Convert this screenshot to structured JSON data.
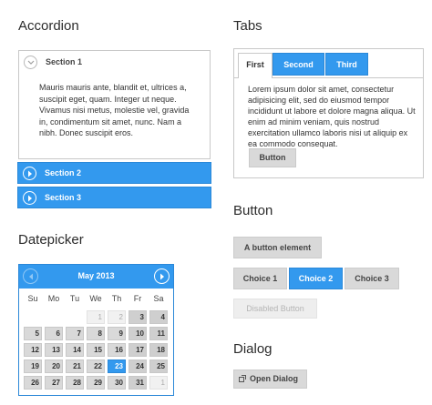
{
  "accordion": {
    "heading": "Accordion",
    "sections": [
      {
        "title": "Section 1",
        "body": "Mauris mauris ante, blandit et, ultrices a, suscipit eget, quam. Integer ut neque. Vivamus nisi metus, molestie vel, gravida in, condimentum sit amet, nunc. Nam a nibh. Donec suscipit eros."
      },
      {
        "title": "Section 2"
      },
      {
        "title": "Section 3"
      }
    ]
  },
  "tabs": {
    "heading": "Tabs",
    "items": [
      "First",
      "Second",
      "Third"
    ],
    "active": "First",
    "content": "Lorem ipsum dolor sit amet, consectetur adipisicing elit, sed do eiusmod tempor incididunt ut labore et dolore magna aliqua. Ut enim ad minim veniam, quis nostrud exercitation ullamco laboris nisi ut aliquip ex ea commodo consequat.",
    "button_label": "Button"
  },
  "button": {
    "heading": "Button",
    "element_label": "A button element",
    "choices": [
      "Choice 1",
      "Choice 2",
      "Choice 3"
    ],
    "selected_choice": "Choice 2",
    "disabled_label": "Disabled Button"
  },
  "datepicker": {
    "heading": "Datepicker",
    "month_label": "May 2013",
    "weekdays": [
      "Su",
      "Mo",
      "Tu",
      "We",
      "Th",
      "Fr",
      "Sa"
    ],
    "weeks": [
      [
        "",
        "",
        "",
        "1",
        "2",
        "3",
        "4"
      ],
      [
        "5",
        "6",
        "7",
        "8",
        "9",
        "10",
        "11"
      ],
      [
        "12",
        "13",
        "14",
        "15",
        "16",
        "17",
        "18"
      ],
      [
        "19",
        "20",
        "21",
        "22",
        "23",
        "24",
        "25"
      ],
      [
        "26",
        "27",
        "28",
        "29",
        "30",
        "31",
        "1"
      ]
    ],
    "other_month_days": [
      "1",
      "2"
    ],
    "selected_day": "23"
  },
  "dialog": {
    "heading": "Dialog",
    "open_label": "Open Dialog"
  },
  "colors": {
    "accent": "#3399ee",
    "button_gray": "#d9d9d9",
    "border": "#c8c8c8"
  }
}
